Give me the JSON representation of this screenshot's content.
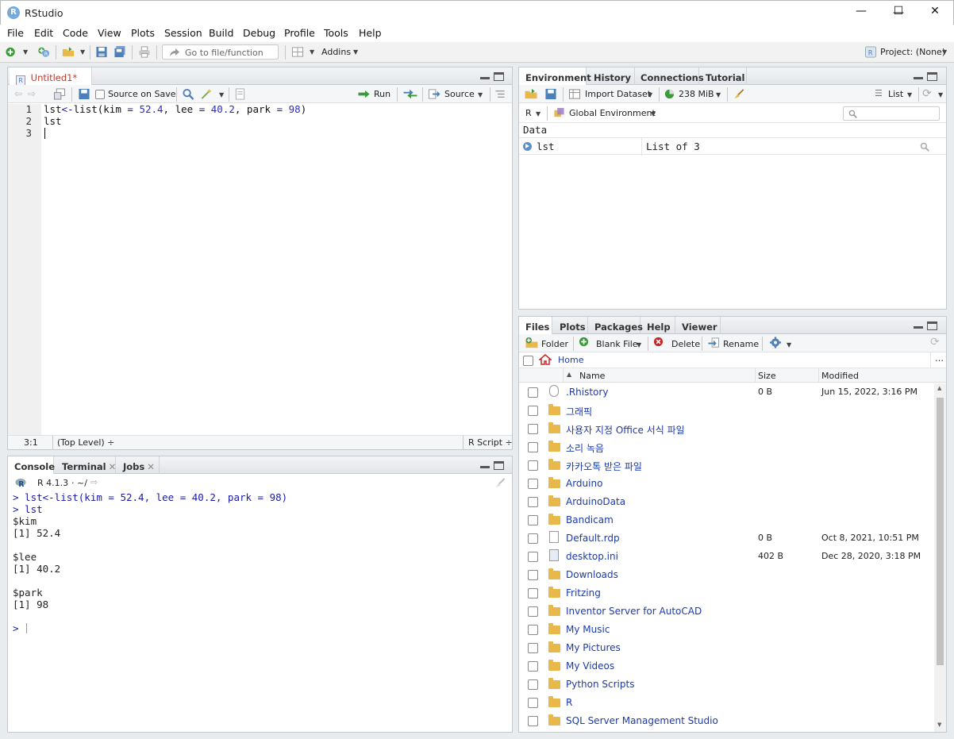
{
  "window": {
    "title": "RStudio",
    "minimize": "—",
    "maximize": "☐",
    "close": "✕"
  },
  "menu": [
    "File",
    "Edit",
    "Code",
    "View",
    "Plots",
    "Session",
    "Build",
    "Debug",
    "Profile",
    "Tools",
    "Help"
  ],
  "toolbar": {
    "goto_placeholder": "Go to file/function",
    "addins": "Addins",
    "project": "Project: (None)"
  },
  "editor": {
    "tab": "Untitled1*",
    "source_on_save": "Source on Save",
    "run": "Run",
    "source": "Source",
    "line_numbers": [
      "1",
      "2",
      "3"
    ],
    "lines": [
      [
        {
          "t": "lst",
          "c": "plain"
        },
        {
          "t": "<-",
          "c": "op"
        },
        {
          "t": "list(kim ",
          "c": "plain"
        },
        {
          "t": "=",
          "c": "op"
        },
        {
          "t": " ",
          "c": "plain"
        },
        {
          "t": "52.4",
          "c": "num"
        },
        {
          "t": ", lee ",
          "c": "plain"
        },
        {
          "t": "=",
          "c": "op"
        },
        {
          "t": " ",
          "c": "plain"
        },
        {
          "t": "40.2",
          "c": "num"
        },
        {
          "t": ", park ",
          "c": "plain"
        },
        {
          "t": "=",
          "c": "op"
        },
        {
          "t": " ",
          "c": "plain"
        },
        {
          "t": "98",
          "c": "num"
        },
        {
          "t": ")",
          "c": "plain"
        }
      ],
      [
        {
          "t": "lst",
          "c": "plain"
        }
      ],
      []
    ],
    "status_pos": "3:1",
    "status_level": "(Top Level) ÷",
    "status_type": "R Script ÷"
  },
  "console": {
    "tabs": [
      "Console",
      "Terminal",
      "Jobs"
    ],
    "version": "R 4.1.3",
    "path": "· ~/",
    "input_lines": [
      "> lst<-list(kim = 52.4, lee = 40.2, park = 98)",
      "> lst"
    ],
    "output_lines": [
      "$kim",
      "[1] 52.4",
      "",
      "$lee",
      "[1] 40.2",
      "",
      "$park",
      "[1] 98",
      ""
    ],
    "prompt": "> "
  },
  "environment": {
    "tabs": [
      "Environment",
      "History",
      "Connections",
      "Tutorial"
    ],
    "import_dataset": "Import Dataset",
    "memory": "238 MiB",
    "view_mode": "List",
    "language": "R",
    "scope": "Global Environment",
    "section": "Data",
    "rows": [
      {
        "name": "lst",
        "value": "List of  3"
      }
    ]
  },
  "files": {
    "tabs": [
      "Files",
      "Plots",
      "Packages",
      "Help",
      "Viewer"
    ],
    "folder": "Folder",
    "blank_file": "Blank File",
    "delete": "Delete",
    "rename": "Rename",
    "path": "Home",
    "more": "…",
    "columns": [
      "Name",
      "Size",
      "Modified"
    ],
    "rows": [
      {
        "name": ".Rhistory",
        "size": "0 B",
        "modified": "Jun 15, 2022, 3:16 PM",
        "icon": "history"
      },
      {
        "name": "그래픽",
        "size": "",
        "modified": "",
        "icon": "folder"
      },
      {
        "name": "사용자 지정 Office 서식 파일",
        "size": "",
        "modified": "",
        "icon": "folder"
      },
      {
        "name": "소리 녹음",
        "size": "",
        "modified": "",
        "icon": "folder"
      },
      {
        "name": "카카오톡 받은 파일",
        "size": "",
        "modified": "",
        "icon": "folder"
      },
      {
        "name": "Arduino",
        "size": "",
        "modified": "",
        "icon": "folder"
      },
      {
        "name": "ArduinoData",
        "size": "",
        "modified": "",
        "icon": "folder"
      },
      {
        "name": "Bandicam",
        "size": "",
        "modified": "",
        "icon": "folder"
      },
      {
        "name": "Default.rdp",
        "size": "0 B",
        "modified": "Oct 8, 2021, 10:51 PM",
        "icon": "file"
      },
      {
        "name": "desktop.ini",
        "size": "402 B",
        "modified": "Dec 28, 2020, 3:18 PM",
        "icon": "settings"
      },
      {
        "name": "Downloads",
        "size": "",
        "modified": "",
        "icon": "folder"
      },
      {
        "name": "Fritzing",
        "size": "",
        "modified": "",
        "icon": "folder"
      },
      {
        "name": "Inventor Server for AutoCAD",
        "size": "",
        "modified": "",
        "icon": "folder"
      },
      {
        "name": "My Music",
        "size": "",
        "modified": "",
        "icon": "folder"
      },
      {
        "name": "My Pictures",
        "size": "",
        "modified": "",
        "icon": "folder"
      },
      {
        "name": "My Videos",
        "size": "",
        "modified": "",
        "icon": "folder"
      },
      {
        "name": "Python Scripts",
        "size": "",
        "modified": "",
        "icon": "folder"
      },
      {
        "name": "R",
        "size": "",
        "modified": "",
        "icon": "folder"
      },
      {
        "name": "SQL Server Management Studio",
        "size": "",
        "modified": "",
        "icon": "folder"
      }
    ]
  },
  "colors": {
    "keyword_blue": "#1a1aa6",
    "number_blue": "#2b2bc8",
    "link_blue": "#1c3aa8",
    "tab_red": "#c0392b"
  }
}
